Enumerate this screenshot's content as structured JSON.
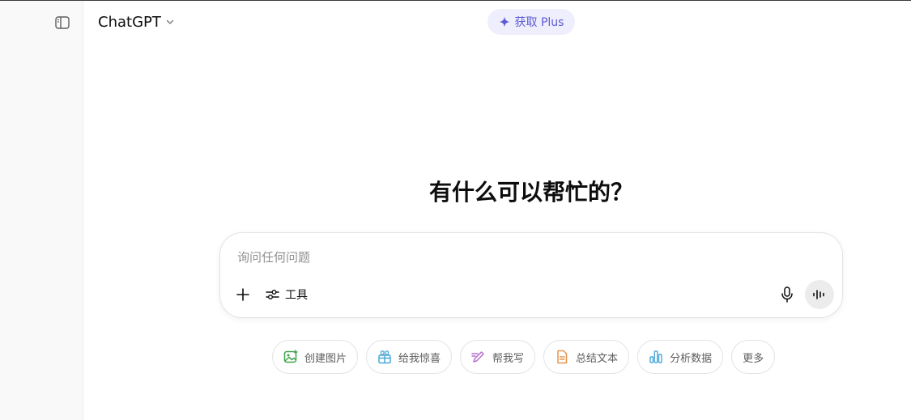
{
  "header": {
    "model_name": "ChatGPT",
    "upgrade_label": "获取 Plus"
  },
  "main": {
    "greeting": "有什么可以帮忙的？"
  },
  "composer": {
    "placeholder": "询问任何问题",
    "value": "",
    "tools_label": "工具"
  },
  "suggestions": [
    {
      "label": "创建图片",
      "icon": "image-icon",
      "color": "#3fa34d"
    },
    {
      "label": "给我惊喜",
      "icon": "gift-icon",
      "color": "#4aa8d8"
    },
    {
      "label": "帮我写",
      "icon": "pen-icon",
      "color": "#b46fd0"
    },
    {
      "label": "总结文本",
      "icon": "document-icon",
      "color": "#e6954f"
    },
    {
      "label": "分析数据",
      "icon": "bar-chart-icon",
      "color": "#4aa8d8"
    },
    {
      "label": "更多",
      "icon": "",
      "color": ""
    }
  ],
  "colors": {
    "accent": "#5b5bd6",
    "pill_bg": "#eeeefc",
    "sidebar_bg": "#f9f9f9"
  }
}
